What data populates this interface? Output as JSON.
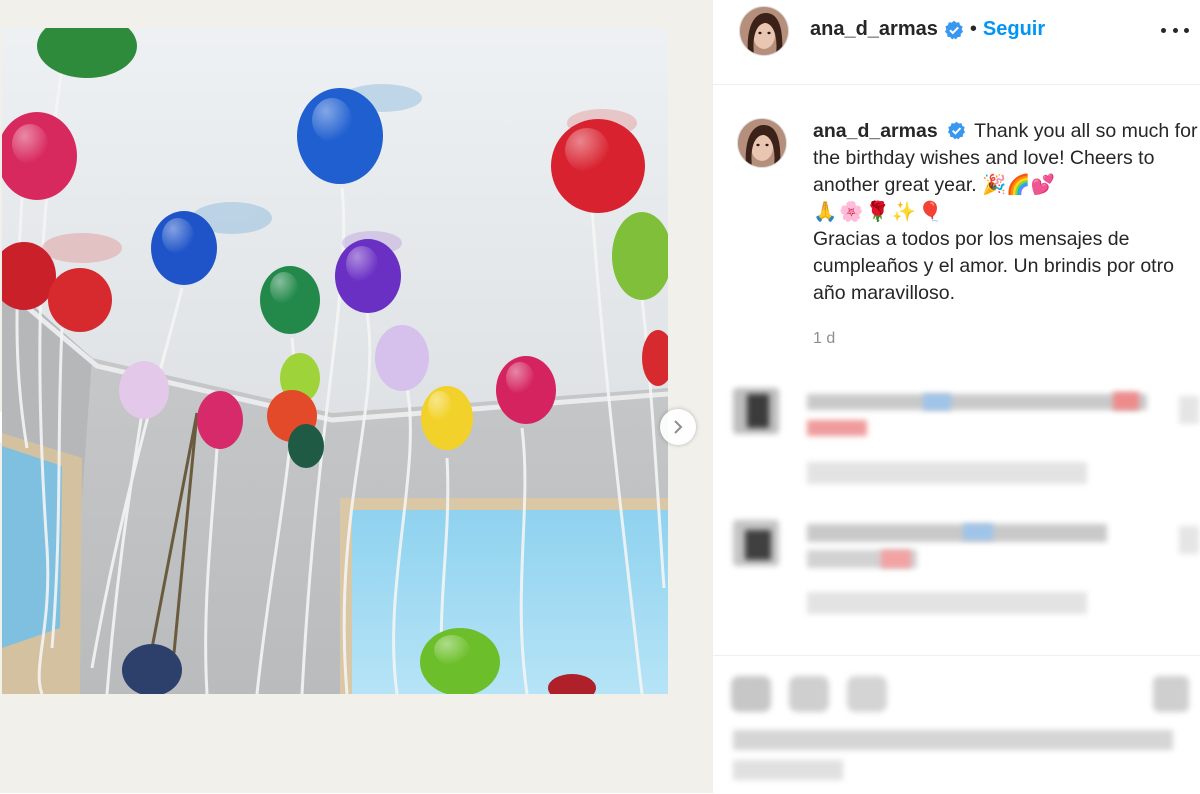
{
  "post": {
    "username": "ana_d_armas",
    "follow_label": "Seguir",
    "separator": "•",
    "caption_line_1": "Thank you all so much for the birthday wishes and love! Cheers to another great year. 🎉🌈💕",
    "caption_emoji_row": "🙏🌸🌹✨🎈",
    "caption_line_2": "Gracias a todos por los mensajes de cumpleaños y el amor. Un brindis por otro año maravilloso.",
    "timestamp": "1 d"
  },
  "colors": {
    "follow_blue": "#0095f6",
    "verified_blue": "#3897f0",
    "text": "#262626",
    "muted": "#8e8e8e"
  },
  "icons": {
    "verified": "verified-badge-icon",
    "more": "more-options-icon",
    "next": "chevron-right-icon"
  }
}
